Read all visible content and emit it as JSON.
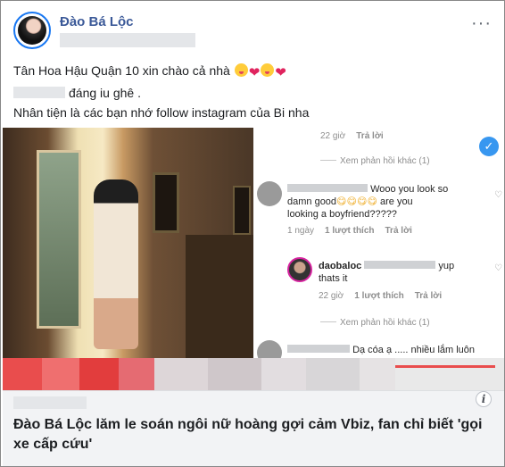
{
  "post": {
    "author": "Đào Bá Lộc",
    "more_label": "···",
    "text_line1": "Tân Hoa Hậu Quận 10 xin chào cả nhà",
    "text_line2": "đáng iu ghê .",
    "text_line3": "Nhân tiện là các bạn nhớ follow instagram của Bi nha"
  },
  "instagram": {
    "top_meta_time": "22 giờ",
    "top_meta_reply": "Trả lời",
    "view_more_1": "Xem phản hồi khác (1)",
    "comment1_text_a": "Wooo you look so",
    "comment1_text_b": "damn good",
    "comment1_text_c": "are you",
    "comment1_text_d": "looking a boyfriend?????",
    "comment1_time": "1 ngày",
    "comment1_likes": "1 lượt thích",
    "comment1_reply": "Trả lời",
    "comment2_user": "daobaloc",
    "comment2_text_a": "yup",
    "comment2_text_b": "thats it",
    "comment2_time": "22 giờ",
    "comment2_likes": "1 lượt thích",
    "comment2_reply": "Trả lời",
    "view_more_2": "Xem phản hồi khác (1)",
    "comment3_text": "Dạ cóa ạ ..... nhiều lắm luôn"
  },
  "link_preview": {
    "info_icon": "i",
    "headline": "Đào Bá Lộc lăm le soán ngôi nữ hoàng gợi cảm Vbiz, fan chỉ biết 'gọi xe cấp cứu'"
  },
  "colors": {
    "author_link": "#3b5998",
    "verified": "#3897f0",
    "banner_red": "#e94d4d"
  },
  "icons": [
    "avatar",
    "more-icon",
    "verified-check-icon",
    "heart-outline-icon",
    "info-icon",
    "heart-emoji",
    "face-emoji"
  ]
}
